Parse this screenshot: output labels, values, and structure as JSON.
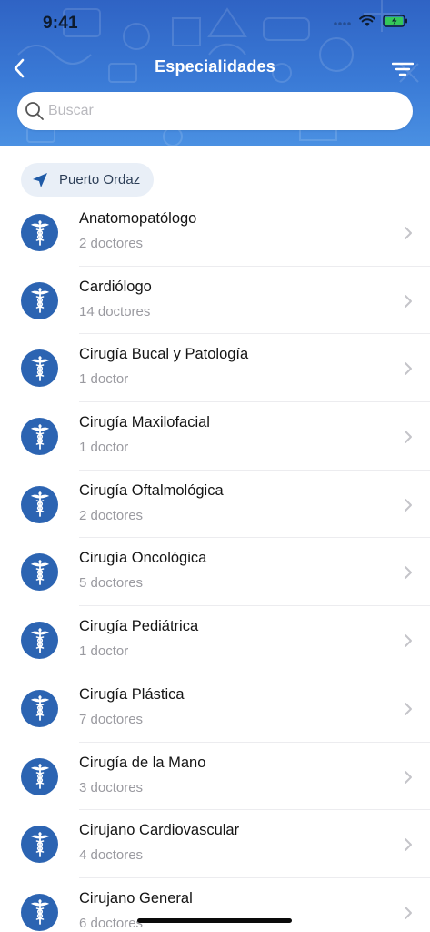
{
  "status_bar": {
    "time": "9:41"
  },
  "nav": {
    "title": "Especialidades"
  },
  "search": {
    "placeholder": "Buscar"
  },
  "location": {
    "label": "Puerto Ordaz"
  },
  "colors": {
    "primary": "#2c64b2",
    "header_top": "#2f63c4",
    "header_bottom": "#4a90e2",
    "battery": "#34c759"
  },
  "specialties": [
    {
      "name": "Anatomopatólogo",
      "count": "2 doctores"
    },
    {
      "name": "Cardiólogo",
      "count": "14 doctores"
    },
    {
      "name": "Cirugía Bucal y Patología",
      "count": "1 doctor"
    },
    {
      "name": "Cirugía Maxilofacial",
      "count": "1 doctor"
    },
    {
      "name": "Cirugía Oftalmológica",
      "count": "2 doctores"
    },
    {
      "name": "Cirugía Oncológica",
      "count": "5 doctores"
    },
    {
      "name": "Cirugía Pediátrica",
      "count": "1 doctor"
    },
    {
      "name": "Cirugía Plástica",
      "count": "7 doctores"
    },
    {
      "name": "Cirugía de la Mano",
      "count": "3 doctores"
    },
    {
      "name": "Cirujano Cardiovascular",
      "count": "4 doctores"
    },
    {
      "name": "Cirujano General",
      "count": "6 doctores"
    }
  ]
}
